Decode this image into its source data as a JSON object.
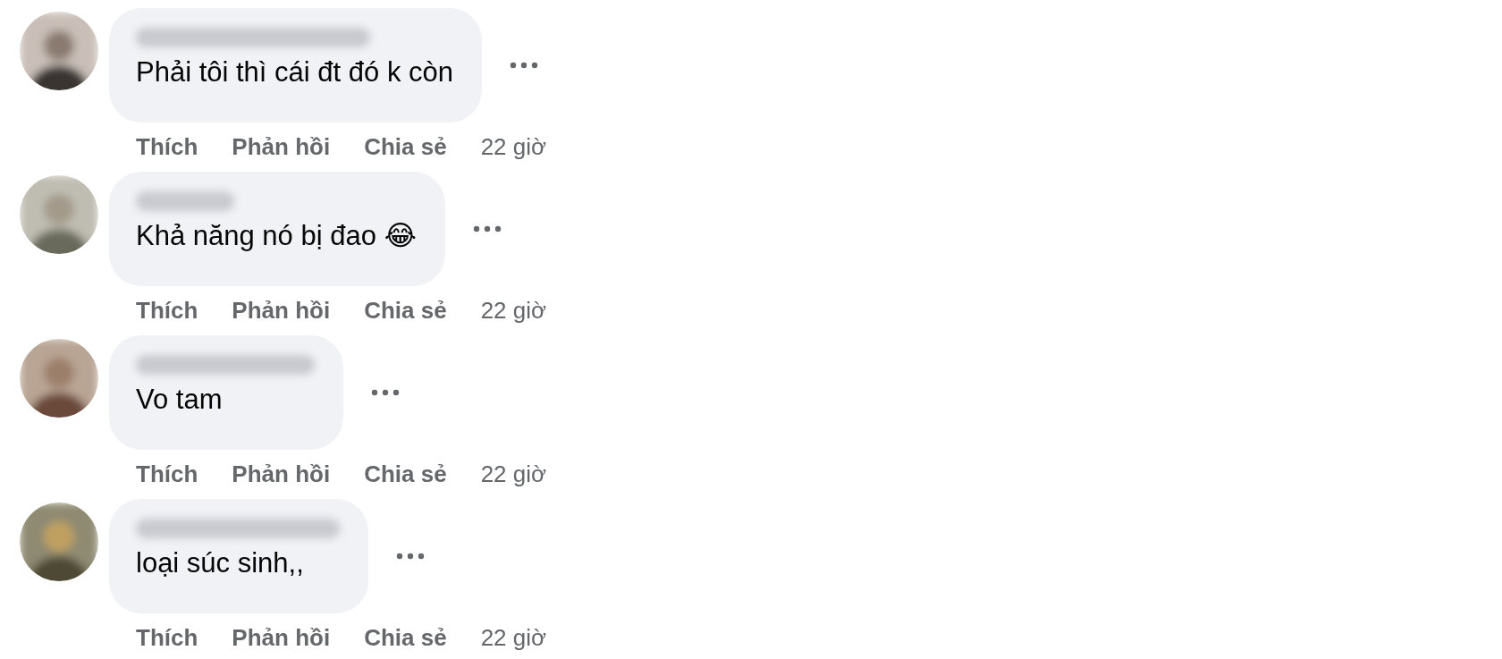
{
  "comments": [
    {
      "text": "Phải tôi thì cái đt đó k còn",
      "actions": [
        "Thích",
        "Phản hồi",
        "Chia sẻ"
      ],
      "time": "22 giờ"
    },
    {
      "text": "Khả năng nó bị đao 😂",
      "actions": [
        "Thích",
        "Phản hồi",
        "Chia sẻ"
      ],
      "time": "22 giờ"
    },
    {
      "text": "Vo tam",
      "actions": [
        "Thích",
        "Phản hồi",
        "Chia sẻ"
      ],
      "time": "22 giờ"
    },
    {
      "text": "loại súc sinh,,",
      "actions": [
        "Thích",
        "Phản hồi",
        "Chia sẻ"
      ],
      "time": "22 giờ"
    }
  ]
}
